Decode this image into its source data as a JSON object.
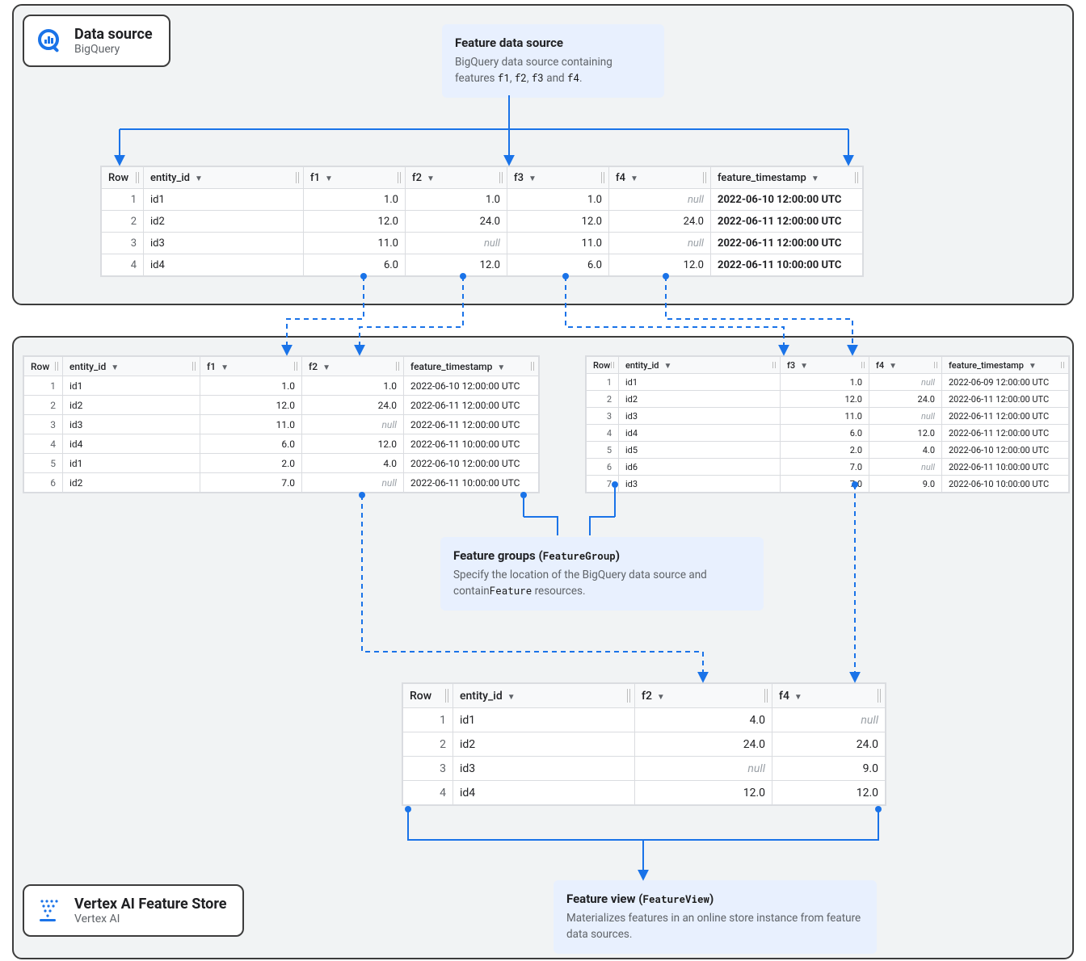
{
  "products": {
    "data_source": {
      "title": "Data source",
      "subtitle": "BigQuery"
    },
    "vertex": {
      "title": "Vertex AI Feature Store",
      "subtitle": "Vertex AI"
    }
  },
  "callouts": {
    "feature_data_source": {
      "title": "Feature data source",
      "body_prefix": "BigQuery data source containing features ",
      "codes": [
        "f1",
        "f2",
        "f3",
        "f4"
      ],
      "joiners": [
        ", ",
        ", ",
        " and "
      ],
      "suffix": "."
    },
    "feature_groups": {
      "title": "Feature groups (",
      "title_code": "FeatureGroup",
      "title_suffix": ")",
      "body_prefix": "Specify the location of the BigQuery data source and contain",
      "body_code": "Feature",
      "body_suffix": " resources."
    },
    "feature_view": {
      "title": "Feature view (",
      "title_code": "FeatureView",
      "title_suffix": ")",
      "body": "Materializes features in an online store instance from feature data sources."
    }
  },
  "tables": {
    "main": {
      "headers": [
        "Row",
        "entity_id",
        "f1",
        "f2",
        "f3",
        "f4",
        "feature_timestamp"
      ],
      "rows": [
        {
          "row": "1",
          "entity_id": "id1",
          "f1": "1.0",
          "f2": "1.0",
          "f3": "1.0",
          "f4": "null",
          "ts": "2022-06-10 12:00:00 UTC"
        },
        {
          "row": "2",
          "entity_id": "id2",
          "f1": "12.0",
          "f2": "24.0",
          "f3": "12.0",
          "f4": "24.0",
          "ts": "2022-06-11 12:00:00 UTC"
        },
        {
          "row": "3",
          "entity_id": "id3",
          "f1": "11.0",
          "f2": "null",
          "f3": "11.0",
          "f4": "null",
          "ts": "2022-06-11 12:00:00 UTC"
        },
        {
          "row": "4",
          "entity_id": "id4",
          "f1": "6.0",
          "f2": "12.0",
          "f3": "6.0",
          "f4": "12.0",
          "ts": "2022-06-11 10:00:00 UTC"
        }
      ]
    },
    "fg_left": {
      "headers": [
        "Row",
        "entity_id",
        "f1",
        "f2",
        "feature_timestamp"
      ],
      "rows": [
        {
          "row": "1",
          "entity_id": "id1",
          "c1": "1.0",
          "c2": "1.0",
          "ts": "2022-06-10 12:00:00 UTC"
        },
        {
          "row": "2",
          "entity_id": "id2",
          "c1": "12.0",
          "c2": "24.0",
          "ts": "2022-06-11 12:00:00 UTC"
        },
        {
          "row": "3",
          "entity_id": "id3",
          "c1": "11.0",
          "c2": "null",
          "ts": "2022-06-11 12:00:00 UTC"
        },
        {
          "row": "4",
          "entity_id": "id4",
          "c1": "6.0",
          "c2": "12.0",
          "ts": "2022-06-11 10:00:00 UTC"
        },
        {
          "row": "5",
          "entity_id": "id1",
          "c1": "2.0",
          "c2": "4.0",
          "ts": "2022-06-10 12:00:00 UTC"
        },
        {
          "row": "6",
          "entity_id": "id2",
          "c1": "7.0",
          "c2": "null",
          "ts": "2022-06-11 10:00:00 UTC"
        }
      ]
    },
    "fg_right": {
      "headers": [
        "Row",
        "entity_id",
        "f3",
        "f4",
        "feature_timestamp"
      ],
      "rows": [
        {
          "row": "1",
          "entity_id": "id1",
          "c1": "1.0",
          "c2": "null",
          "ts": "2022-06-09 12:00:00 UTC"
        },
        {
          "row": "2",
          "entity_id": "id2",
          "c1": "12.0",
          "c2": "24.0",
          "ts": "2022-06-11 12:00:00 UTC"
        },
        {
          "row": "3",
          "entity_id": "id3",
          "c1": "11.0",
          "c2": "null",
          "ts": "2022-06-11 12:00:00 UTC"
        },
        {
          "row": "4",
          "entity_id": "id4",
          "c1": "6.0",
          "c2": "12.0",
          "ts": "2022-06-11 12:00:00 UTC"
        },
        {
          "row": "5",
          "entity_id": "id5",
          "c1": "2.0",
          "c2": "4.0",
          "ts": "2022-06-10 12:00:00 UTC"
        },
        {
          "row": "6",
          "entity_id": "id6",
          "c1": "7.0",
          "c2": "null",
          "ts": "2022-06-11 10:00:00 UTC"
        },
        {
          "row": "7",
          "entity_id": "id3",
          "c1": "7.0",
          "c2": "9.0",
          "ts": "2022-06-10 10:00:00 UTC"
        }
      ]
    },
    "feature_view": {
      "headers": [
        "Row",
        "entity_id",
        "f2",
        "f4"
      ],
      "rows": [
        {
          "row": "1",
          "entity_id": "id1",
          "c1": "4.0",
          "c2": "null"
        },
        {
          "row": "2",
          "entity_id": "id2",
          "c1": "24.0",
          "c2": "24.0"
        },
        {
          "row": "3",
          "entity_id": "id3",
          "c1": "null",
          "c2": "9.0"
        },
        {
          "row": "4",
          "entity_id": "id4",
          "c1": "12.0",
          "c2": "12.0"
        }
      ]
    }
  }
}
